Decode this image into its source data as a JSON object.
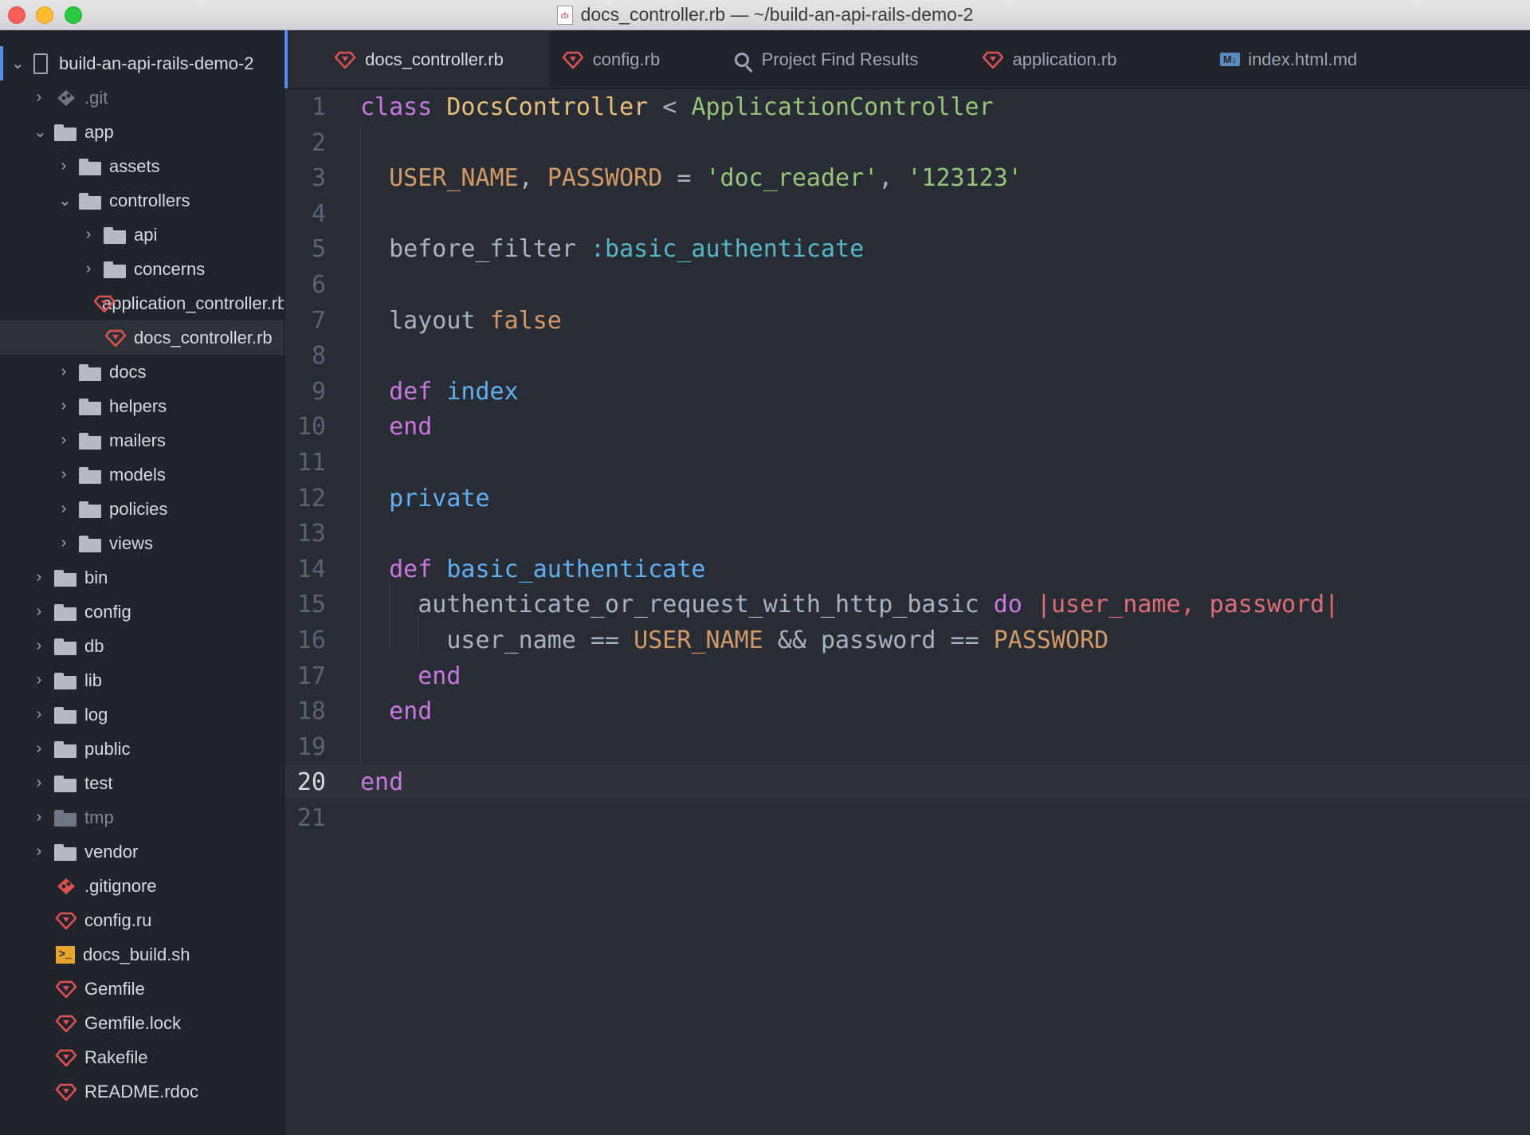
{
  "window": {
    "title": "docs_controller.rb — ~/build-an-api-rails-demo-2",
    "file_badge": "rb"
  },
  "sidebar": {
    "root": "build-an-api-rails-demo-2",
    "items": [
      {
        "label": ".git",
        "icon": "git-icon",
        "depth": 1,
        "chevron": "right",
        "muted": true
      },
      {
        "label": "app",
        "icon": "folder-icon",
        "depth": 1,
        "chevron": "down"
      },
      {
        "label": "assets",
        "icon": "folder-icon",
        "depth": 2,
        "chevron": "right"
      },
      {
        "label": "controllers",
        "icon": "folder-icon",
        "depth": 2,
        "chevron": "down"
      },
      {
        "label": "api",
        "icon": "folder-icon",
        "depth": 3,
        "chevron": "right"
      },
      {
        "label": "concerns",
        "icon": "folder-icon",
        "depth": 3,
        "chevron": "right"
      },
      {
        "label": "application_controller.rb",
        "icon": "ruby-icon",
        "depth": 3
      },
      {
        "label": "docs_controller.rb",
        "icon": "ruby-icon",
        "depth": 3,
        "selected": true
      },
      {
        "label": "docs",
        "icon": "folder-icon",
        "depth": 2,
        "chevron": "right"
      },
      {
        "label": "helpers",
        "icon": "folder-icon",
        "depth": 2,
        "chevron": "right"
      },
      {
        "label": "mailers",
        "icon": "folder-icon",
        "depth": 2,
        "chevron": "right"
      },
      {
        "label": "models",
        "icon": "folder-icon",
        "depth": 2,
        "chevron": "right"
      },
      {
        "label": "policies",
        "icon": "folder-icon",
        "depth": 2,
        "chevron": "right"
      },
      {
        "label": "views",
        "icon": "folder-icon",
        "depth": 2,
        "chevron": "right"
      },
      {
        "label": "bin",
        "icon": "folder-icon",
        "depth": 1,
        "chevron": "right"
      },
      {
        "label": "config",
        "icon": "folder-icon",
        "depth": 1,
        "chevron": "right"
      },
      {
        "label": "db",
        "icon": "folder-icon",
        "depth": 1,
        "chevron": "right"
      },
      {
        "label": "lib",
        "icon": "folder-icon",
        "depth": 1,
        "chevron": "right"
      },
      {
        "label": "log",
        "icon": "folder-icon",
        "depth": 1,
        "chevron": "right"
      },
      {
        "label": "public",
        "icon": "folder-icon",
        "depth": 1,
        "chevron": "right"
      },
      {
        "label": "test",
        "icon": "folder-icon",
        "depth": 1,
        "chevron": "right"
      },
      {
        "label": "tmp",
        "icon": "folder-icon",
        "depth": 1,
        "chevron": "right",
        "muted": true
      },
      {
        "label": "vendor",
        "icon": "folder-icon",
        "depth": 1,
        "chevron": "right"
      },
      {
        "label": ".gitignore",
        "icon": "git-icon",
        "depth": 1
      },
      {
        "label": "config.ru",
        "icon": "ruby-icon",
        "depth": 1
      },
      {
        "label": "docs_build.sh",
        "icon": "shell-icon",
        "depth": 1
      },
      {
        "label": "Gemfile",
        "icon": "ruby-icon",
        "depth": 1
      },
      {
        "label": "Gemfile.lock",
        "icon": "ruby-icon",
        "depth": 1
      },
      {
        "label": "Rakefile",
        "icon": "ruby-icon",
        "depth": 1
      },
      {
        "label": "README.rdoc",
        "icon": "ruby-icon",
        "depth": 1
      }
    ]
  },
  "tabs": [
    {
      "label": "docs_controller.rb",
      "icon": "ruby-icon",
      "active": true
    },
    {
      "label": "config.rb",
      "icon": "ruby-icon"
    },
    {
      "label": "Project Find Results",
      "icon": "search-icon"
    },
    {
      "label": "application.rb",
      "icon": "ruby-icon"
    },
    {
      "label": "index.html.md",
      "icon": "markdown-icon"
    }
  ],
  "editor": {
    "current_line": 20,
    "lines": [
      [
        [
          "kw",
          "class "
        ],
        [
          "cls",
          "DocsController"
        ],
        [
          "plain",
          " < "
        ],
        [
          "inh",
          "ApplicationController"
        ]
      ],
      [],
      [
        [
          "plain",
          "  "
        ],
        [
          "const",
          "USER_NAME"
        ],
        [
          "plain",
          ", "
        ],
        [
          "const",
          "PASSWORD"
        ],
        [
          "plain",
          " = "
        ],
        [
          "str",
          "'doc_reader'"
        ],
        [
          "plain",
          ", "
        ],
        [
          "str",
          "'123123'"
        ]
      ],
      [],
      [
        [
          "plain",
          "  before_filter "
        ],
        [
          "sym",
          ":basic_authenticate"
        ]
      ],
      [],
      [
        [
          "plain",
          "  layout "
        ],
        [
          "const",
          "false"
        ]
      ],
      [],
      [
        [
          "plain",
          "  "
        ],
        [
          "kw",
          "def "
        ],
        [
          "fn",
          "index"
        ]
      ],
      [
        [
          "plain",
          "  "
        ],
        [
          "kw",
          "end"
        ]
      ],
      [],
      [
        [
          "plain",
          "  "
        ],
        [
          "fn",
          "private"
        ]
      ],
      [],
      [
        [
          "plain",
          "  "
        ],
        [
          "kw",
          "def "
        ],
        [
          "fn",
          "basic_authenticate"
        ]
      ],
      [
        [
          "plain",
          "    authenticate_or_request_with_http_basic "
        ],
        [
          "kw",
          "do "
        ],
        [
          "param",
          "|user_name, password|"
        ]
      ],
      [
        [
          "plain",
          "      user_name == "
        ],
        [
          "const",
          "USER_NAME"
        ],
        [
          "plain",
          " && password == "
        ],
        [
          "const",
          "PASSWORD"
        ]
      ],
      [
        [
          "plain",
          "    "
        ],
        [
          "kw",
          "end"
        ]
      ],
      [
        [
          "plain",
          "  "
        ],
        [
          "kw",
          "end"
        ]
      ],
      [],
      [
        [
          "kw",
          "end"
        ]
      ],
      []
    ]
  },
  "colors": {
    "keyword": "#c678dd",
    "class": "#e5c07b",
    "string": "#98c379",
    "constant": "#d19a66",
    "symbol": "#56b6c2",
    "function": "#61afef",
    "param": "#e06c75",
    "accent": "#568af2"
  }
}
